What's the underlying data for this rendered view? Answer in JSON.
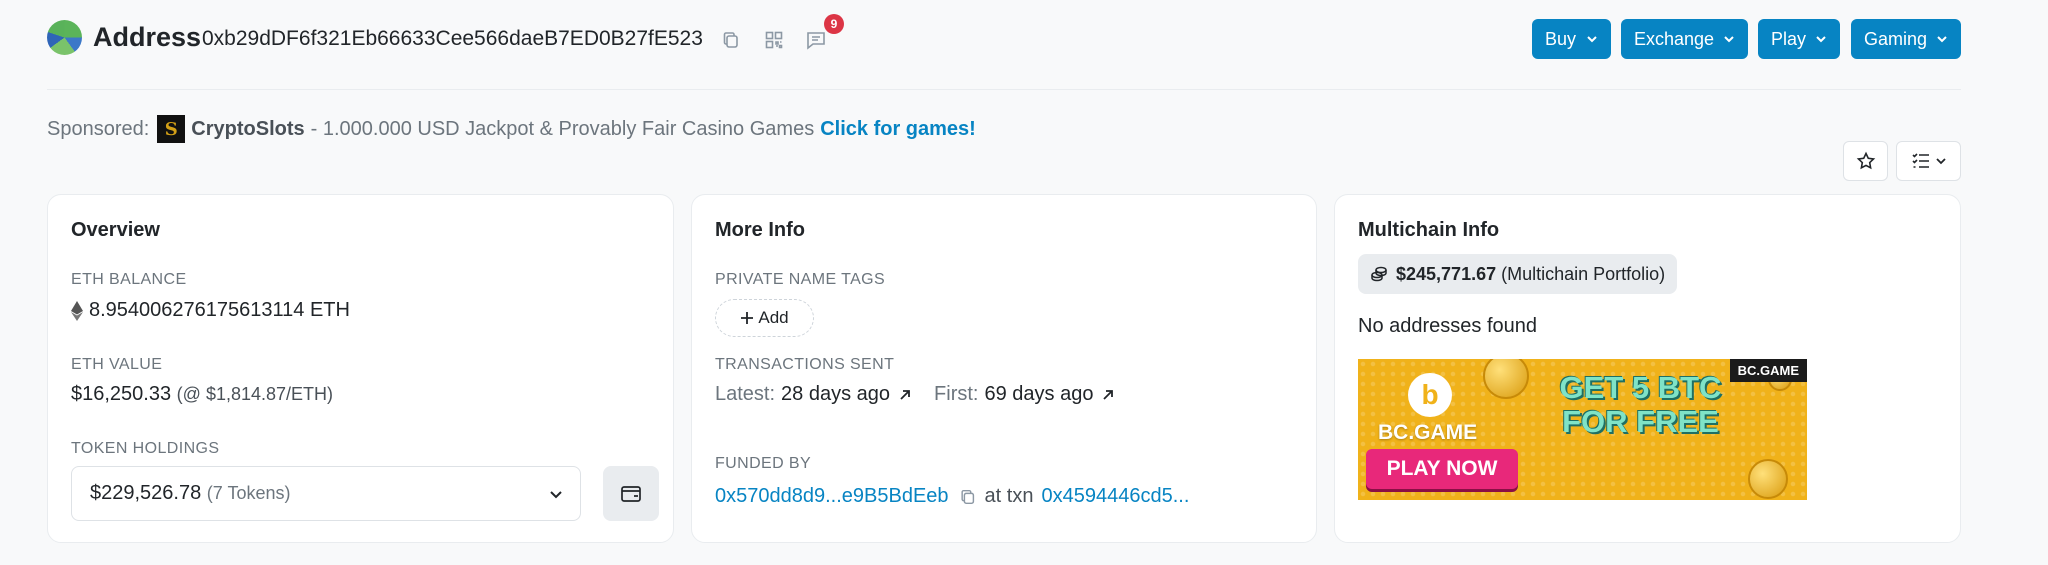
{
  "header": {
    "title": "Address",
    "address": "0xb29dDF6f321Eb66633Cee566daeB7ED0B27fE523",
    "notification_count": "9",
    "nav_buttons": [
      {
        "label": "Buy"
      },
      {
        "label": "Exchange"
      },
      {
        "label": "Play"
      },
      {
        "label": "Gaming"
      }
    ]
  },
  "sponsored": {
    "prefix": "Sponsored:",
    "logo_glyph": "S",
    "brand": "CryptoSlots",
    "text": "- 1.000.000 USD Jackpot & Provably Fair Casino Games",
    "cta": "Click for games!"
  },
  "overview": {
    "title": "Overview",
    "eth_balance_label": "ETH BALANCE",
    "eth_balance": "8.954006276175613114 ETH",
    "eth_value_label": "ETH VALUE",
    "eth_value": "$16,250.33",
    "eth_price": "(@ $1,814.87/ETH)",
    "token_holdings_label": "TOKEN HOLDINGS",
    "token_holdings_value": "$229,526.78",
    "token_holdings_count": "(7 Tokens)"
  },
  "more_info": {
    "title": "More Info",
    "private_tags_label": "PRIVATE NAME TAGS",
    "add_label": "Add",
    "tx_sent_label": "TRANSACTIONS SENT",
    "latest_label": "Latest:",
    "latest_value": "28 days ago",
    "first_label": "First:",
    "first_value": "69 days ago",
    "funded_by_label": "FUNDED BY",
    "funded_by_address": "0x570dd8d9...e9B5BdEeb",
    "at_txn_label": "at txn",
    "txn_hash": "0x4594446cd5..."
  },
  "multichain": {
    "title": "Multichain Info",
    "portfolio_value": "$245,771.67",
    "portfolio_label": "(Multichain Portfolio)",
    "no_addresses": "No addresses found",
    "banner": {
      "brand": "BC.GAME",
      "corner_brand": "BC.GAME",
      "headline": "GET 5 BTC FOR FREE",
      "cta": "PLAY NOW"
    }
  },
  "colors": {
    "primary": "#0784c3",
    "badge": "#dc3545",
    "text": "#212529",
    "muted": "#6c757d"
  }
}
